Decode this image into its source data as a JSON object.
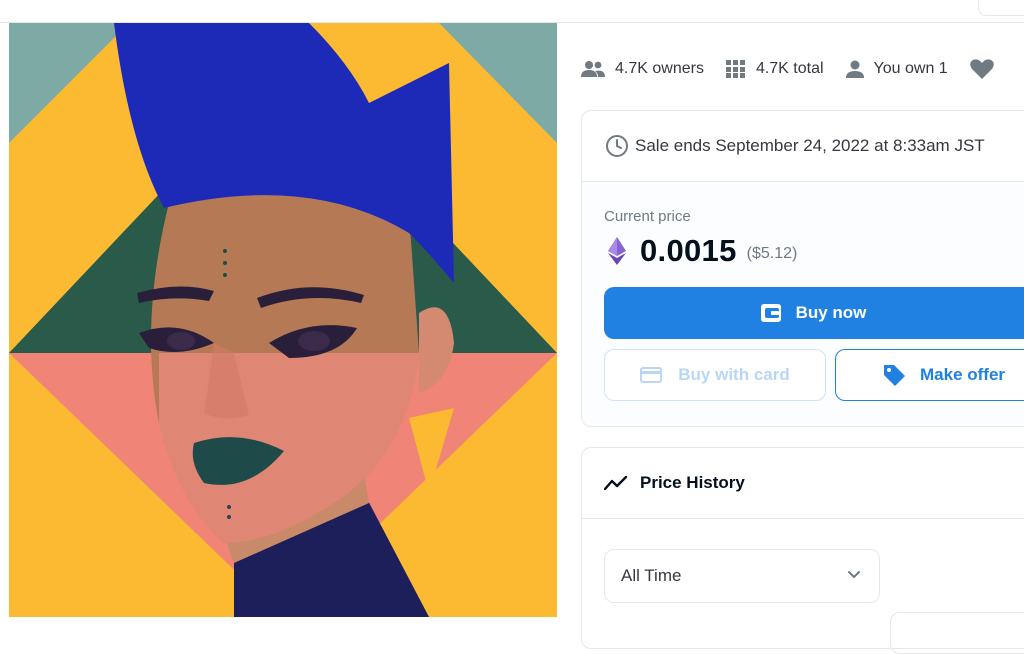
{
  "stats": {
    "owners": "4.7K owners",
    "total": "4.7K total",
    "you_own": "You own 1"
  },
  "sale": {
    "ends_text": "Sale ends September 24, 2022 at 8:33am JST",
    "price_label": "Current price",
    "price_eth": "0.0015",
    "price_usd": "($5.12)",
    "buy_now": "Buy now",
    "buy_with_card": "Buy with card",
    "make_offer": "Make offer"
  },
  "price_history": {
    "title": "Price History",
    "range_selected": "All Time"
  },
  "colors": {
    "accent": "#2081e2",
    "art_bg": "#7eaaa6",
    "art_yellow": "#fcb932",
    "art_green": "#2a5a4a",
    "art_coral": "#f08476",
    "art_blue": "#1d2ab8"
  }
}
